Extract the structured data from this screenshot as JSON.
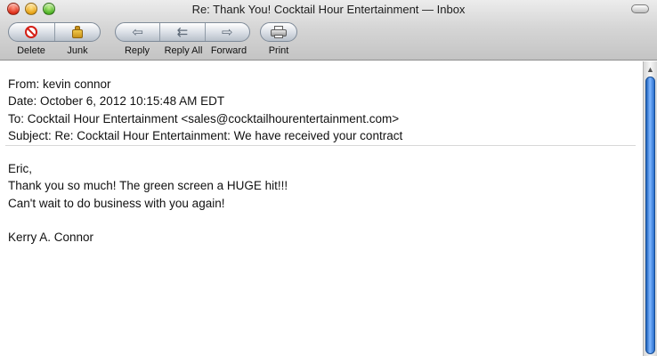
{
  "window": {
    "title": "Re: Thank You! Cocktail Hour Entertainment — Inbox"
  },
  "toolbar": {
    "delete_label": "Delete",
    "junk_label": "Junk",
    "reply_label": "Reply",
    "reply_all_label": "Reply All",
    "forward_label": "Forward",
    "print_label": "Print",
    "icons": {
      "delete": "delete-icon",
      "junk": "junk-icon",
      "reply": "reply-arrow-icon",
      "reply_all": "reply-all-arrow-icon",
      "forward": "forward-arrow-icon",
      "print": "printer-icon"
    }
  },
  "email": {
    "from": "From: kevin connor",
    "date": "Date: October 6, 2012 10:15:48 AM EDT",
    "to": "To: Cocktail Hour Entertainment <sales@cocktailhourentertainment.com>",
    "subject": "Subject: Re: Cocktail Hour Entertainment: We have received your contract",
    "body": [
      "Eric,",
      "Thank you so much! The green screen a HUGE hit!!!",
      "Can't wait to do business with you again!",
      "",
      "Kerry A. Connor"
    ]
  },
  "colors": {
    "delete_red": "#d41f16",
    "scroll_blue": "#2a6fcc"
  }
}
